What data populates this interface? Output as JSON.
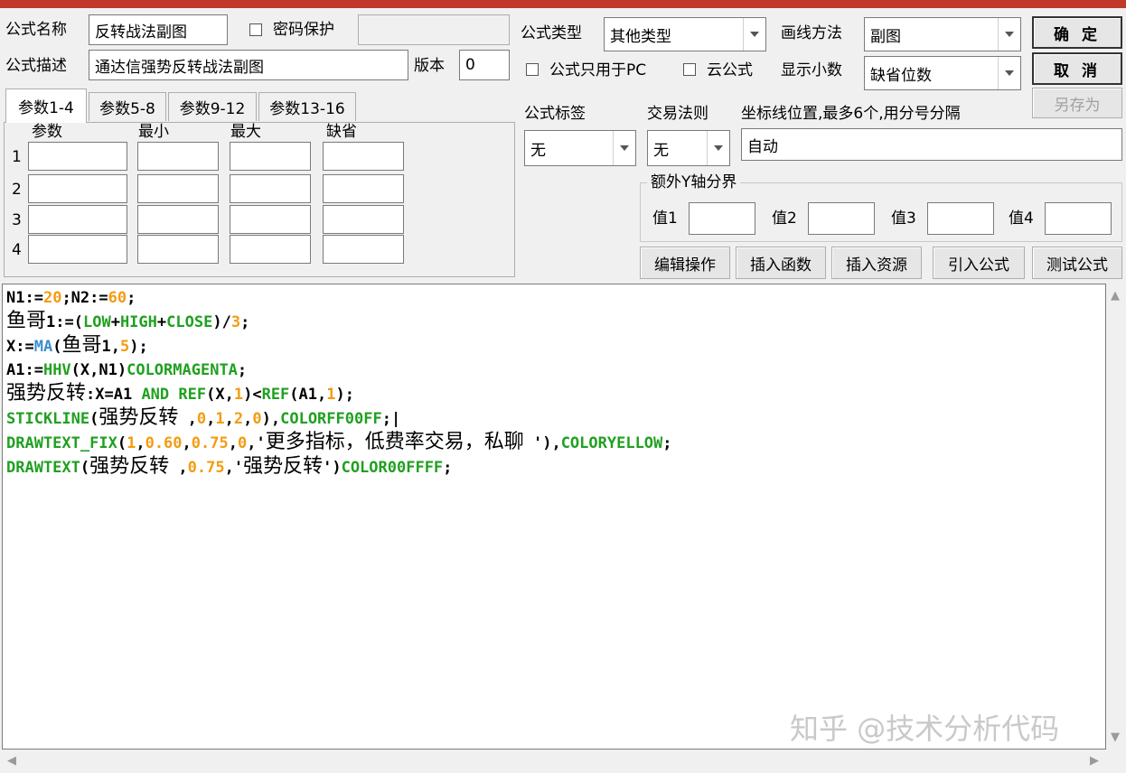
{
  "colors": {
    "titlebar": "#c0392b",
    "number": "#f39c12",
    "function": "#20a020",
    "builtin_blue": "#3a8fd0"
  },
  "form": {
    "name_label": "公式名称",
    "name_value": "反转战法副图",
    "password_label": "密码保护",
    "password_checked": false,
    "desc_label": "公式描述",
    "desc_value": "通达信强势反转战法副图",
    "version_label": "版本",
    "version_value": "0",
    "type_label": "公式类型",
    "type_value": "其他类型",
    "draw_label": "画线方法",
    "draw_value": "副图",
    "pc_only_label": "公式只用于PC",
    "pc_only_checked": false,
    "cloud_label": "云公式",
    "cloud_checked": false,
    "decimals_label": "显示小数",
    "decimals_value": "缺省位数",
    "tag_label": "公式标签",
    "tag_value": "无",
    "trade_label": "交易法则",
    "trade_value": "无",
    "axis_label": "坐标线位置,最多6个,用分号分隔",
    "axis_value": "自动",
    "extra_y_label": "额外Y轴分界",
    "y_values": [
      "值1",
      "值2",
      "值3",
      "值4"
    ]
  },
  "buttons": {
    "ok": "确 定",
    "cancel": "取 消",
    "save_as": "另存为",
    "edit": "编辑操作",
    "insert_func": "插入函数",
    "insert_res": "插入资源",
    "import": "引入公式",
    "test": "测试公式"
  },
  "tabs": [
    "参数1-4",
    "参数5-8",
    "参数9-12",
    "参数13-16"
  ],
  "param_headers": [
    "参数",
    "最小",
    "最大",
    "缺省"
  ],
  "param_rows": [
    "1",
    "2",
    "3",
    "4"
  ],
  "watermark": "知乎 @技术分析代码"
}
